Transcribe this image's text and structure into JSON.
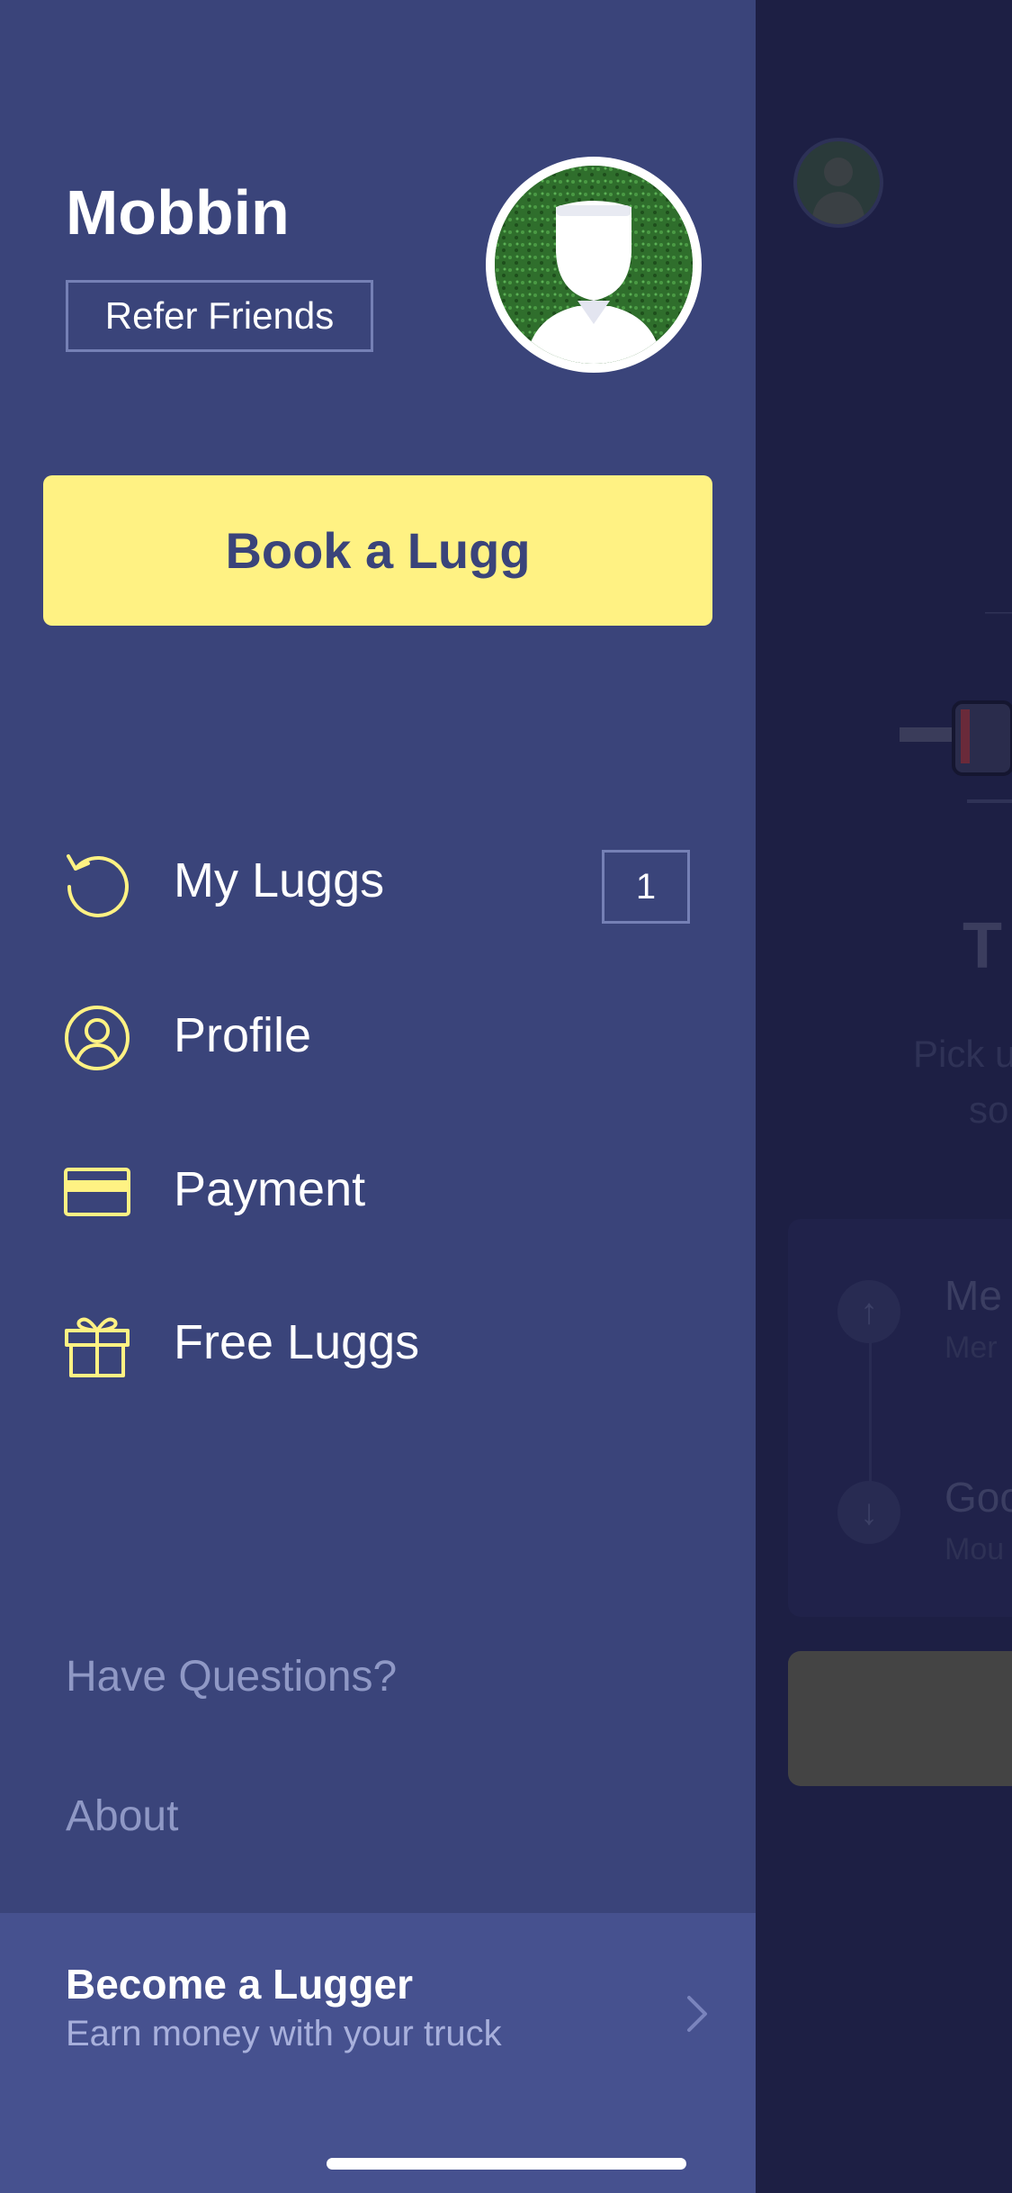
{
  "background_screen": {
    "title_fragment": "T",
    "subtitle_fragment_1": "Pick u",
    "subtitle_fragment_2": "so",
    "row1_title_fragment": "Me",
    "row1_sub_fragment": "Mer",
    "row2_title_fragment": "Goo",
    "row2_sub_fragment": "Mou",
    "arrow_up": "↑",
    "arrow_down": "↓"
  },
  "drawer": {
    "user_name": "Mobbin",
    "refer_label": "Refer Friends",
    "book_label": "Book a Lugg",
    "menu": [
      {
        "label": "My Luggs",
        "icon": "history-icon",
        "badge": "1"
      },
      {
        "label": "Profile",
        "icon": "profile-icon"
      },
      {
        "label": "Payment",
        "icon": "credit-card-icon"
      },
      {
        "label": "Free Luggs",
        "icon": "gift-icon"
      }
    ],
    "links": {
      "questions": "Have Questions?",
      "about": "About"
    },
    "promo": {
      "title": "Become a Lugger",
      "subtitle": "Earn money with your truck"
    }
  },
  "colors": {
    "drawer_bg": "#3a447a",
    "accent_yellow": "#fff283",
    "promo_bg": "#46518f",
    "muted_text": "#8f98c5"
  }
}
